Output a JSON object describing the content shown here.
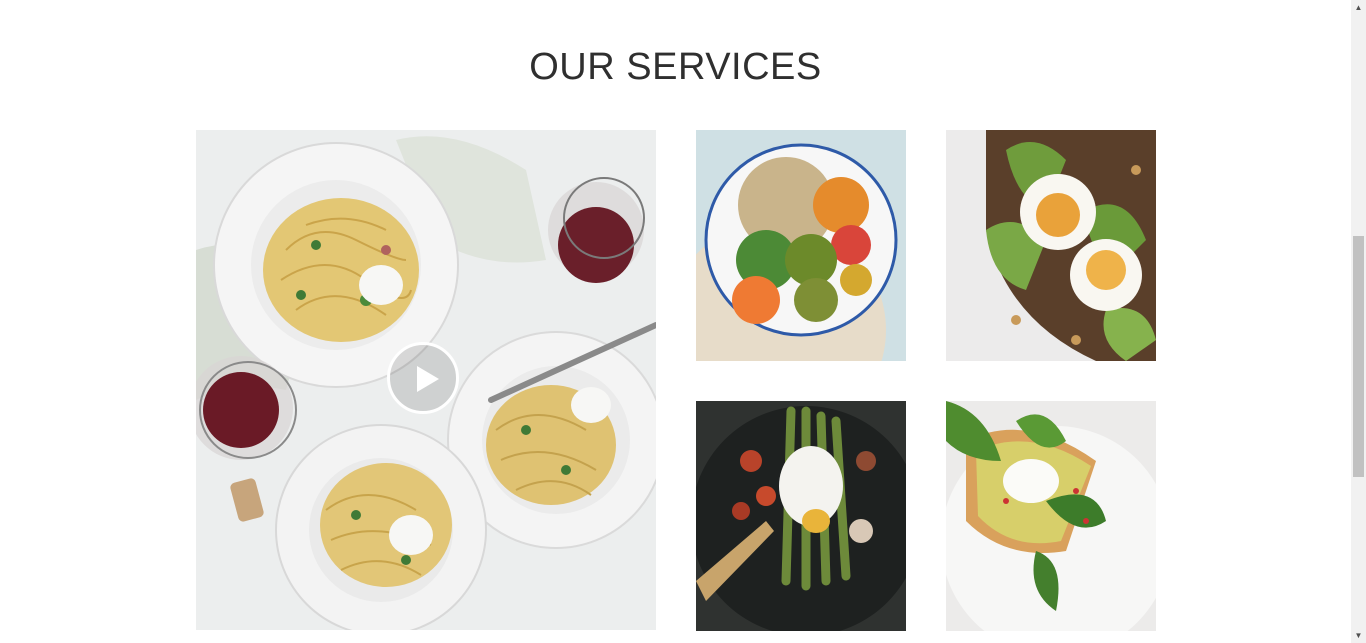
{
  "services": {
    "title": "OUR SERVICES",
    "video": {
      "image": "pasta-plates-photo",
      "play_icon": "play-icon"
    },
    "gallery": [
      {
        "image": "veggie-bowl-photo"
      },
      {
        "image": "avocado-egg-toast-photo"
      },
      {
        "image": "asparagus-poached-egg-photo"
      },
      {
        "image": "spinach-egg-toast-photo"
      }
    ]
  },
  "scrollbar": {
    "up_arrow": "▲",
    "down_arrow": "▼"
  },
  "colors": {
    "title": "#2f2f2f",
    "background": "#ffffff",
    "scroll_track": "#f1f1f1",
    "scroll_thumb": "#c1c1c1"
  }
}
